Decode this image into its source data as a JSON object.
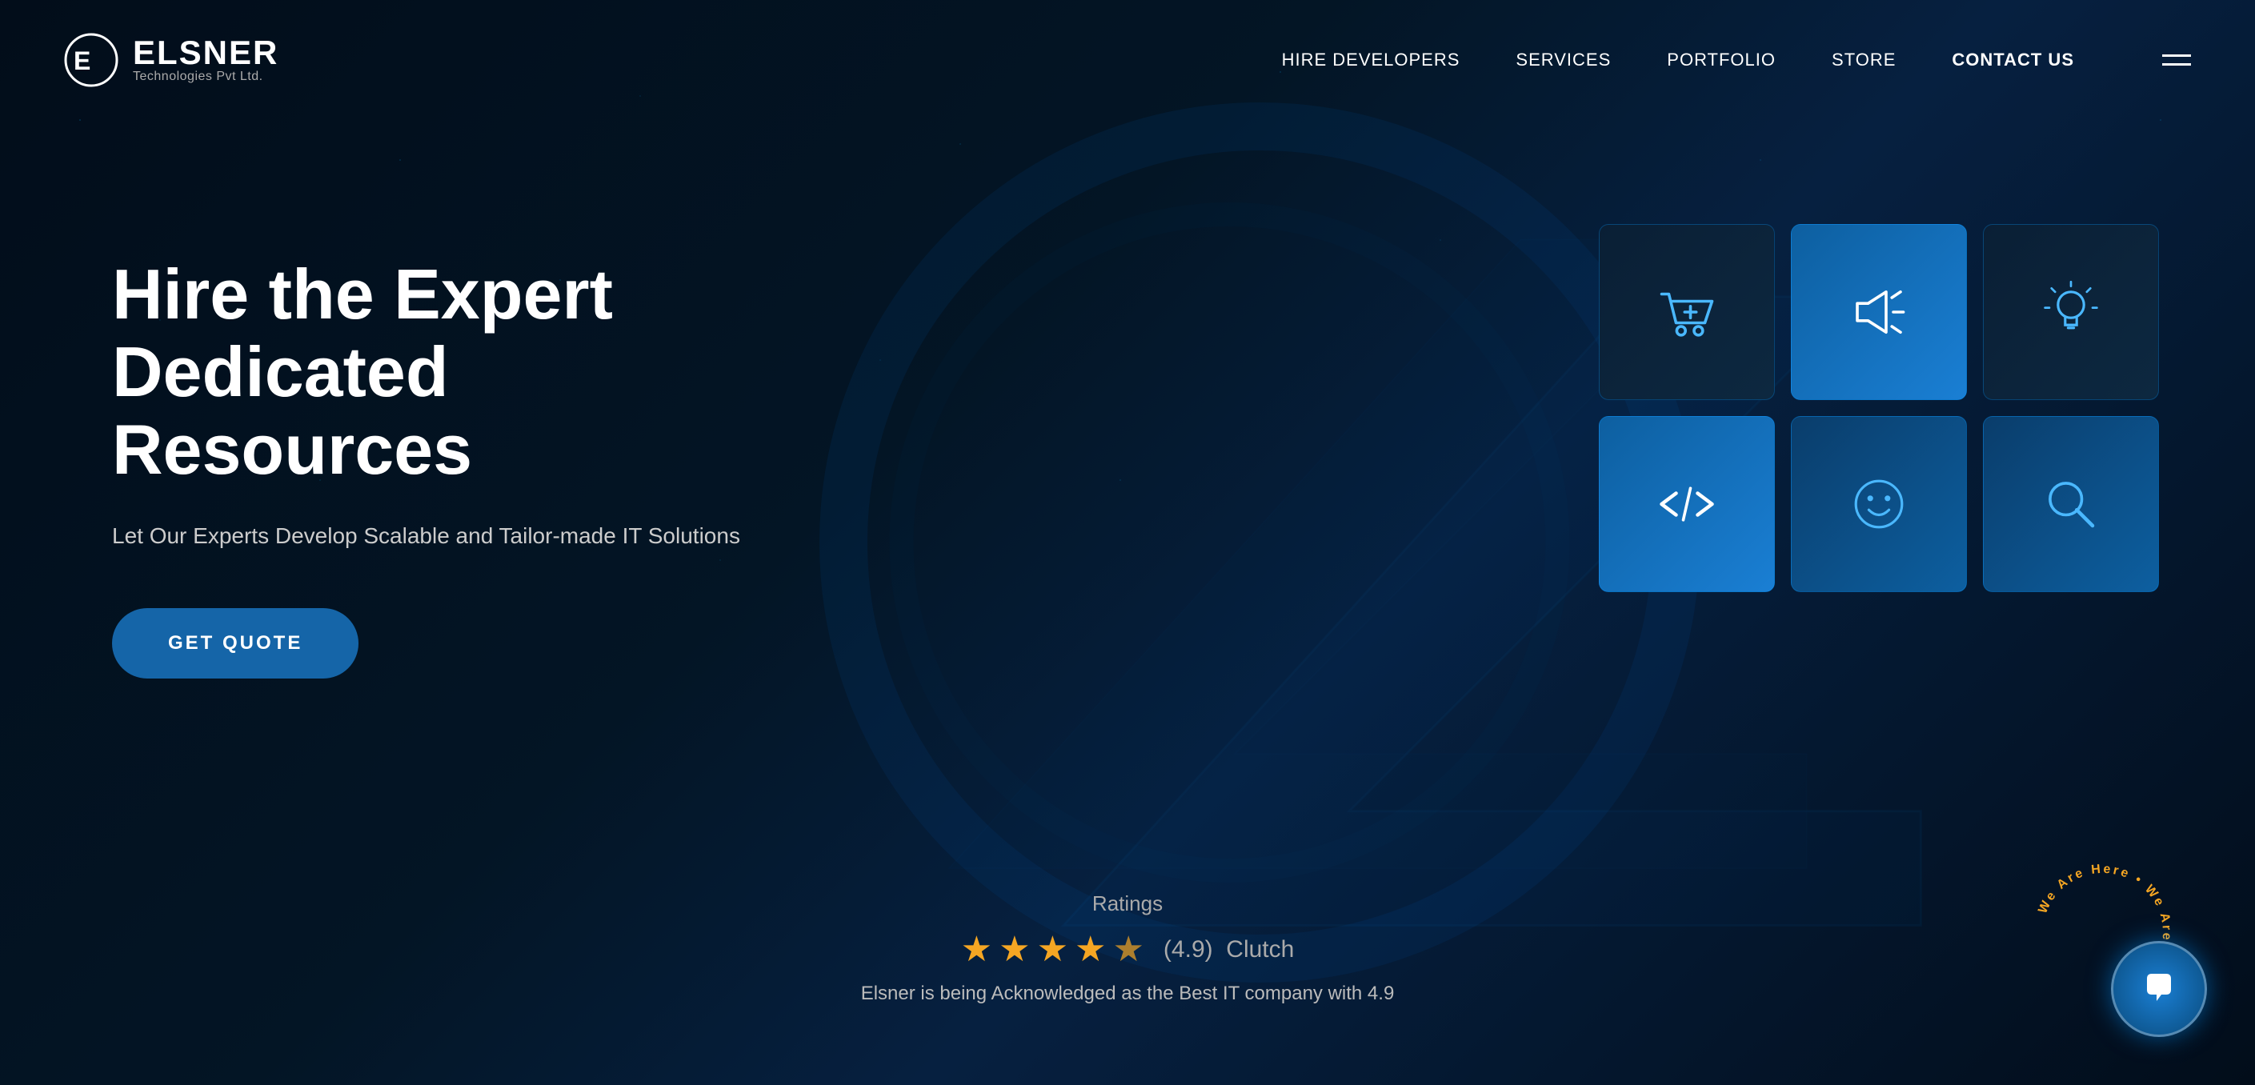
{
  "brand": {
    "name": "ELSNER",
    "tagline": "Technologies Pvt Ltd.",
    "logo_alt": "Elsner Logo"
  },
  "navbar": {
    "links": [
      {
        "label": "HIRE DEVELOPERS",
        "id": "hire-developers"
      },
      {
        "label": "SERVICES",
        "id": "services"
      },
      {
        "label": "PORTFOLIO",
        "id": "portfolio"
      },
      {
        "label": "STORE",
        "id": "store"
      },
      {
        "label": "CONTACT US",
        "id": "contact-us"
      }
    ]
  },
  "hero": {
    "title": "Hire the Expert Dedicated Resources",
    "subtitle": "Let Our Experts Develop Scalable and Tailor-made IT Solutions",
    "cta_label": "GET QUOTE"
  },
  "service_cards": [
    {
      "id": "ecommerce",
      "icon": "cart",
      "style": "dark"
    },
    {
      "id": "marketing",
      "icon": "megaphone",
      "style": "blue"
    },
    {
      "id": "ideas",
      "icon": "lightbulb",
      "style": "dark"
    },
    {
      "id": "development",
      "icon": "code",
      "style": "blue"
    },
    {
      "id": "support",
      "icon": "smiley",
      "style": "teal"
    },
    {
      "id": "search",
      "icon": "search",
      "style": "teal"
    }
  ],
  "ratings": {
    "label": "Ratings",
    "score": "(4.9)",
    "platform": "Clutch",
    "description": "Elsner is being Acknowledged as the Best IT company with 4.9",
    "stars": 4.9
  },
  "chat_widget": {
    "label": "We Are Here"
  }
}
